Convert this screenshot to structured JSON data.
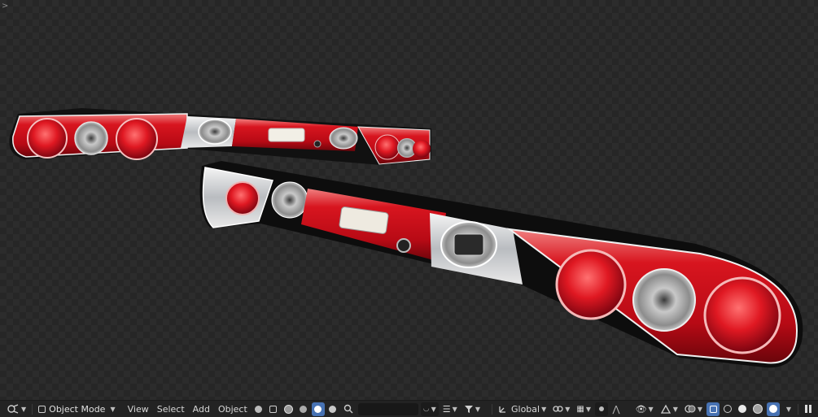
{
  "header": {
    "mode_label": "Object Mode",
    "menus": [
      "View",
      "Select",
      "Add",
      "Object"
    ],
    "transform_orientation": "Global"
  },
  "icons": {
    "editor_type": "viewport-editor-icon",
    "corner_arrow": ">",
    "search": "search-icon",
    "overlay": "overlay-icon",
    "gizmo": "gizmo-icon",
    "pause": "pause-icon"
  },
  "colors": {
    "header_bg": "#232323",
    "active_button": "#4772b3",
    "lamp_red": "#d0101e",
    "chrome": "#d8dadc"
  }
}
